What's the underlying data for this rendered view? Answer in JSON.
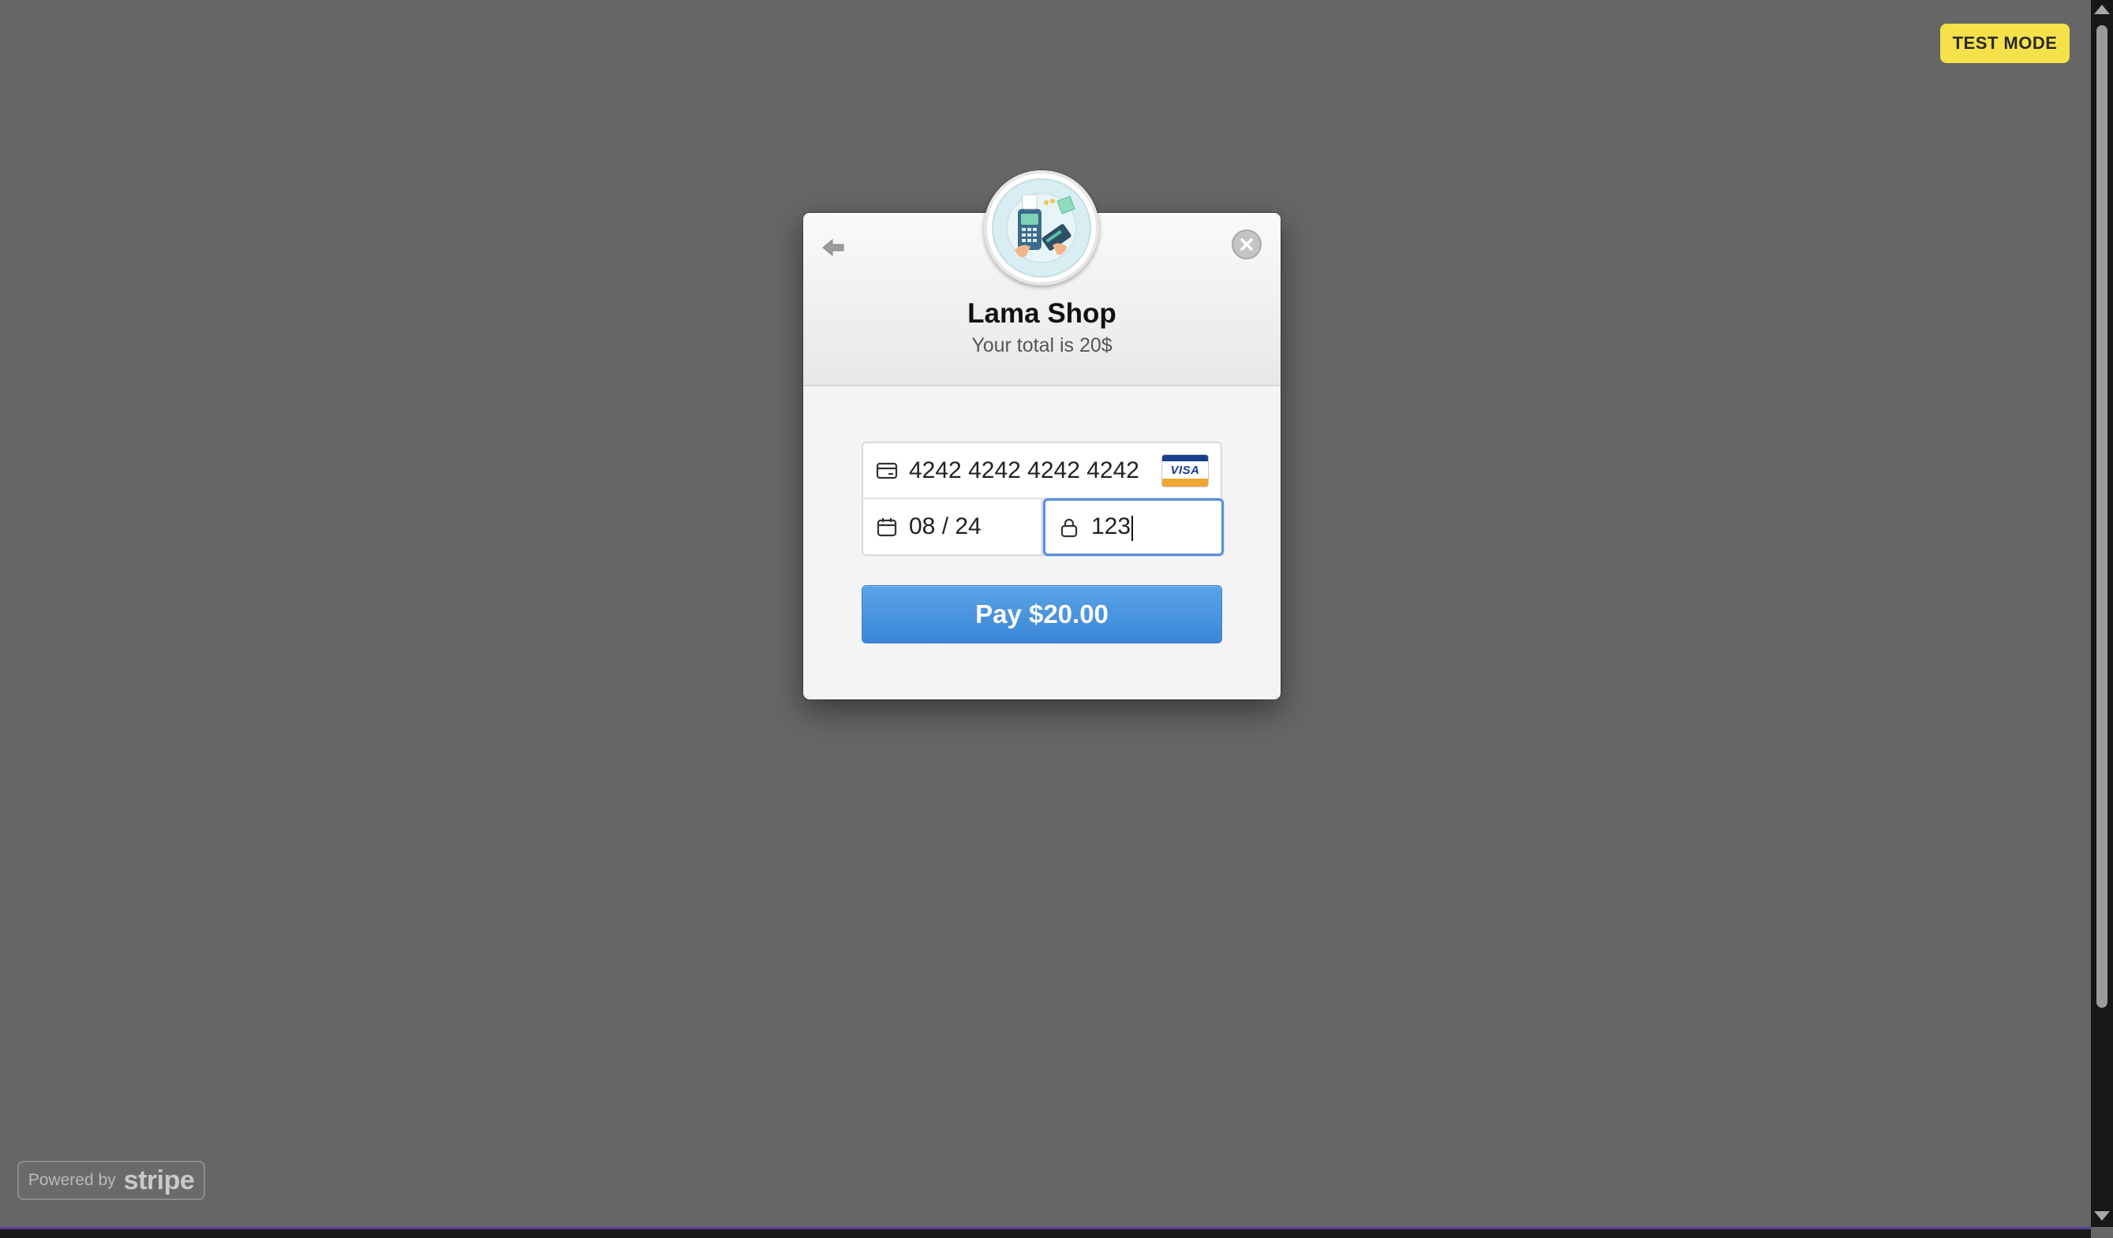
{
  "badge": {
    "label": "TEST MODE"
  },
  "modal": {
    "title": "Lama Shop",
    "subtitle": "Your total is 20$"
  },
  "form": {
    "card_number": "4242 4242 4242 4242",
    "card_brand": "VISA",
    "expiry": "08 / 24",
    "cvc": "123"
  },
  "pay_button": {
    "label": "Pay $20.00"
  },
  "footer": {
    "powered_label": "Powered by",
    "brand": "stripe"
  },
  "colors": {
    "backdrop": "#666666",
    "badge": "#f5e14a",
    "pay_button": "#4a95e0",
    "focus_border": "#5b8fd9"
  },
  "icons": [
    "back-arrow-icon",
    "close-icon",
    "shop-logo-icon",
    "credit-card-icon",
    "visa-card-icon",
    "calendar-icon",
    "lock-icon"
  ]
}
